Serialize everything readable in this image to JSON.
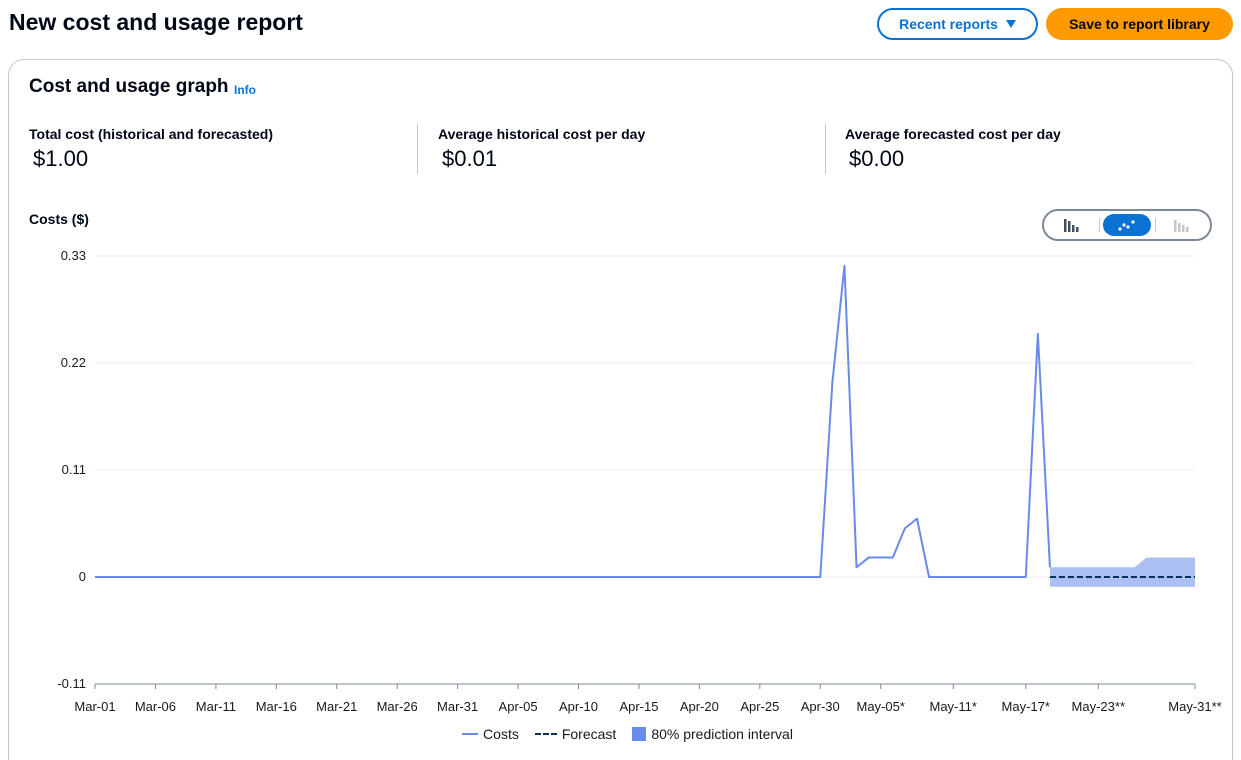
{
  "header": {
    "title": "New cost and usage report",
    "recent_reports_label": "Recent reports",
    "save_label": "Save to report library"
  },
  "panel": {
    "title": "Cost and usage graph",
    "info_label": "Info"
  },
  "stats": [
    {
      "label": "Total cost (historical and forecasted)",
      "value": "$1.00"
    },
    {
      "label": "Average historical cost per day",
      "value": "$0.01"
    },
    {
      "label": "Average forecasted cost per day",
      "value": "$0.00"
    }
  ],
  "chart_type_toggle": {
    "options": [
      "bar-chart-icon",
      "line-chart-icon",
      "stacked-bar-chart-icon"
    ],
    "selected": "line-chart-icon"
  },
  "colors": {
    "costs": "#688ae8",
    "forecast": "#033160",
    "interval": "#688ae8",
    "accent": "#0972d3",
    "primary_button": "#ff9900"
  },
  "chart_data": {
    "type": "line",
    "ylabel": "Costs ($)",
    "xlabel": "",
    "ylim": [
      -0.11,
      0.33
    ],
    "y_ticks": [
      0.33,
      0.22,
      0.11,
      0,
      -0.11
    ],
    "y_tick_labels": [
      "0.33",
      "0.22",
      "0.11",
      "0",
      "-0.11"
    ],
    "grid": true,
    "legend_position": "bottom",
    "x_tick_labels": [
      "Mar-01",
      "Mar-06",
      "Mar-11",
      "Mar-16",
      "Mar-21",
      "Mar-26",
      "Mar-31",
      "Apr-05",
      "Apr-10",
      "Apr-15",
      "Apr-20",
      "Apr-25",
      "Apr-30",
      "May-05*",
      "May-11*",
      "May-17*",
      "May-23**",
      "May-31**"
    ],
    "x_tick_days": [
      0,
      5,
      10,
      15,
      20,
      25,
      30,
      35,
      40,
      45,
      50,
      55,
      60,
      65,
      71,
      77,
      83,
      91
    ],
    "x_day_range": [
      0,
      91
    ],
    "series": [
      {
        "name": "Costs",
        "points": [
          [
            0,
            0
          ],
          [
            60,
            0
          ],
          [
            61,
            0.2
          ],
          [
            62,
            0.32
          ],
          [
            63,
            0.01
          ],
          [
            64,
            0.02
          ],
          [
            65,
            0.02
          ],
          [
            66,
            0.02
          ],
          [
            67,
            0.05
          ],
          [
            68,
            0.06
          ],
          [
            69,
            0
          ],
          [
            70,
            0
          ],
          [
            77,
            0
          ],
          [
            78,
            0.25
          ],
          [
            79,
            0.01
          ]
        ]
      },
      {
        "name": "Forecast",
        "points": [
          [
            79,
            0
          ],
          [
            91,
            0
          ]
        ]
      }
    ],
    "prediction_interval": {
      "name": "80% prediction interval",
      "upper": [
        [
          79,
          0.01
        ],
        [
          86,
          0.01
        ],
        [
          87,
          0.02
        ],
        [
          91,
          0.02
        ]
      ],
      "lower": [
        [
          79,
          -0.01
        ],
        [
          91,
          -0.01
        ]
      ]
    }
  }
}
